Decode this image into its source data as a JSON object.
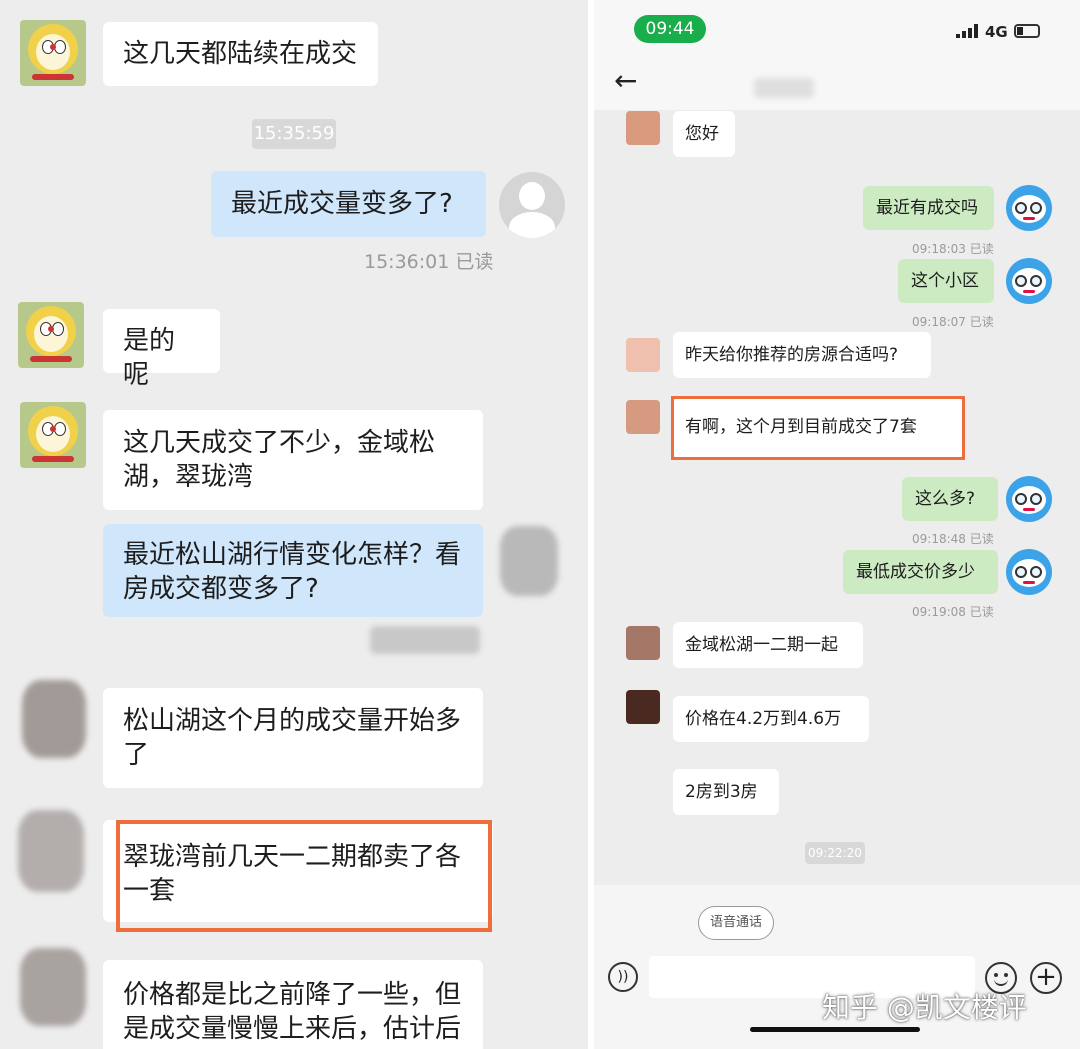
{
  "left_chat": {
    "messages": [
      {
        "text": "这几天都陆续在成交"
      },
      {
        "text": "最近成交量变多了?"
      },
      {
        "text": "是的呢"
      },
      {
        "text": "这几天成交了不少，金域松湖，翠珑湾"
      },
      {
        "text": "最近松山湖行情变化怎样？看房成交都变多了?"
      },
      {
        "text": "松山湖这个月的成交量开始多了"
      },
      {
        "text": "翠珑湾前几天一二期都卖了各一套"
      },
      {
        "text": "价格都是比之前降了一些，但是成交量慢慢上来后，估计后"
      }
    ],
    "timestamp_center": "15:35:59",
    "timestamp_read": "15:36:01 已读"
  },
  "right_chat": {
    "status_bar": {
      "time": "09:44",
      "network": "4G"
    },
    "header": {
      "back_icon": "back-arrow-icon"
    },
    "messages": [
      {
        "text": "您好"
      },
      {
        "text": "最近有成交吗",
        "meta": "09:18:03 已读"
      },
      {
        "text": "这个小区",
        "meta": "09:18:07 已读"
      },
      {
        "text": "昨天给你推荐的房源合适吗?"
      },
      {
        "text": "有啊，这个月到目前成交了7套"
      },
      {
        "text": "这么多?",
        "meta": "09:18:48 已读"
      },
      {
        "text": "最低成交价多少",
        "meta": "09:19:08 已读"
      },
      {
        "text": "金域松湖一二期一起"
      },
      {
        "text": "价格在4.2万到4.6万"
      },
      {
        "text": "2房到3房"
      }
    ],
    "timestamp_center": "09:22:20",
    "voice_call_label": "语音通话",
    "watermark": "知乎 @凯文楼评"
  },
  "colors": {
    "highlight": "#ee6d3d",
    "green_pill": "#1aad4b"
  }
}
